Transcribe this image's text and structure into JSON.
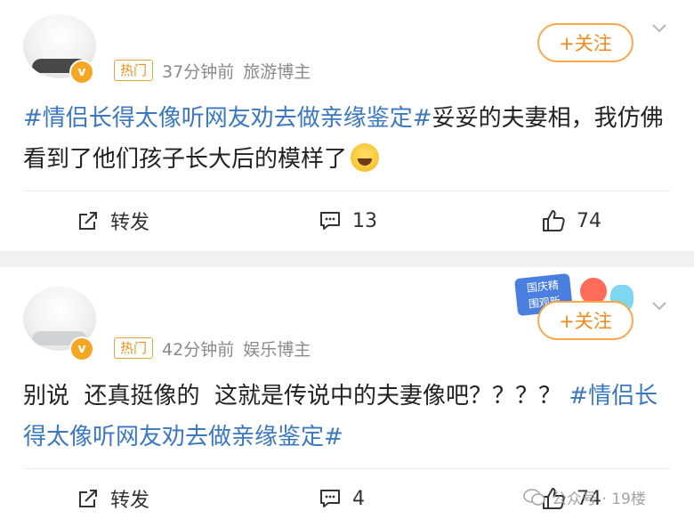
{
  "posts": [
    {
      "hot_tag": "热门",
      "time": "37分钟前",
      "source": "旅游博主",
      "follow_label": "+关注",
      "topic": "#情侣长得太像听网友劝去做亲缘鉴定#",
      "text": "妥妥的夫妻相，我仿佛看到了他们孩子长大后的模样了",
      "emoji": "laughing-crying-emoji",
      "repost_label": "转发",
      "comment_count": "13",
      "like_count": "74"
    },
    {
      "hot_tag": "热门",
      "time": "42分钟前",
      "source": "娱乐博主",
      "follow_label": "+关注",
      "text": "别说  还真挺像的  这就是传说中的夫妻像吧？？？？",
      "topic": "#情侣长得太像听网友劝去做亲缘鉴定#",
      "repost_label": "转发",
      "comment_count": "4",
      "like_count": "74",
      "promo_label": "国庆精\n围观新"
    }
  ],
  "watermark": {
    "text": "公众号 · 19楼"
  },
  "colors": {
    "accent_orange": "#f08a1c",
    "topic_blue": "#3a78c2",
    "meta_gray": "#8a8a8a",
    "verified_badge": "#f5a623"
  },
  "icons": {
    "verified": "v-badge-icon",
    "repost": "repost-icon",
    "comment": "comment-icon",
    "like": "thumbs-up-icon",
    "more": "chevron-down-icon"
  }
}
